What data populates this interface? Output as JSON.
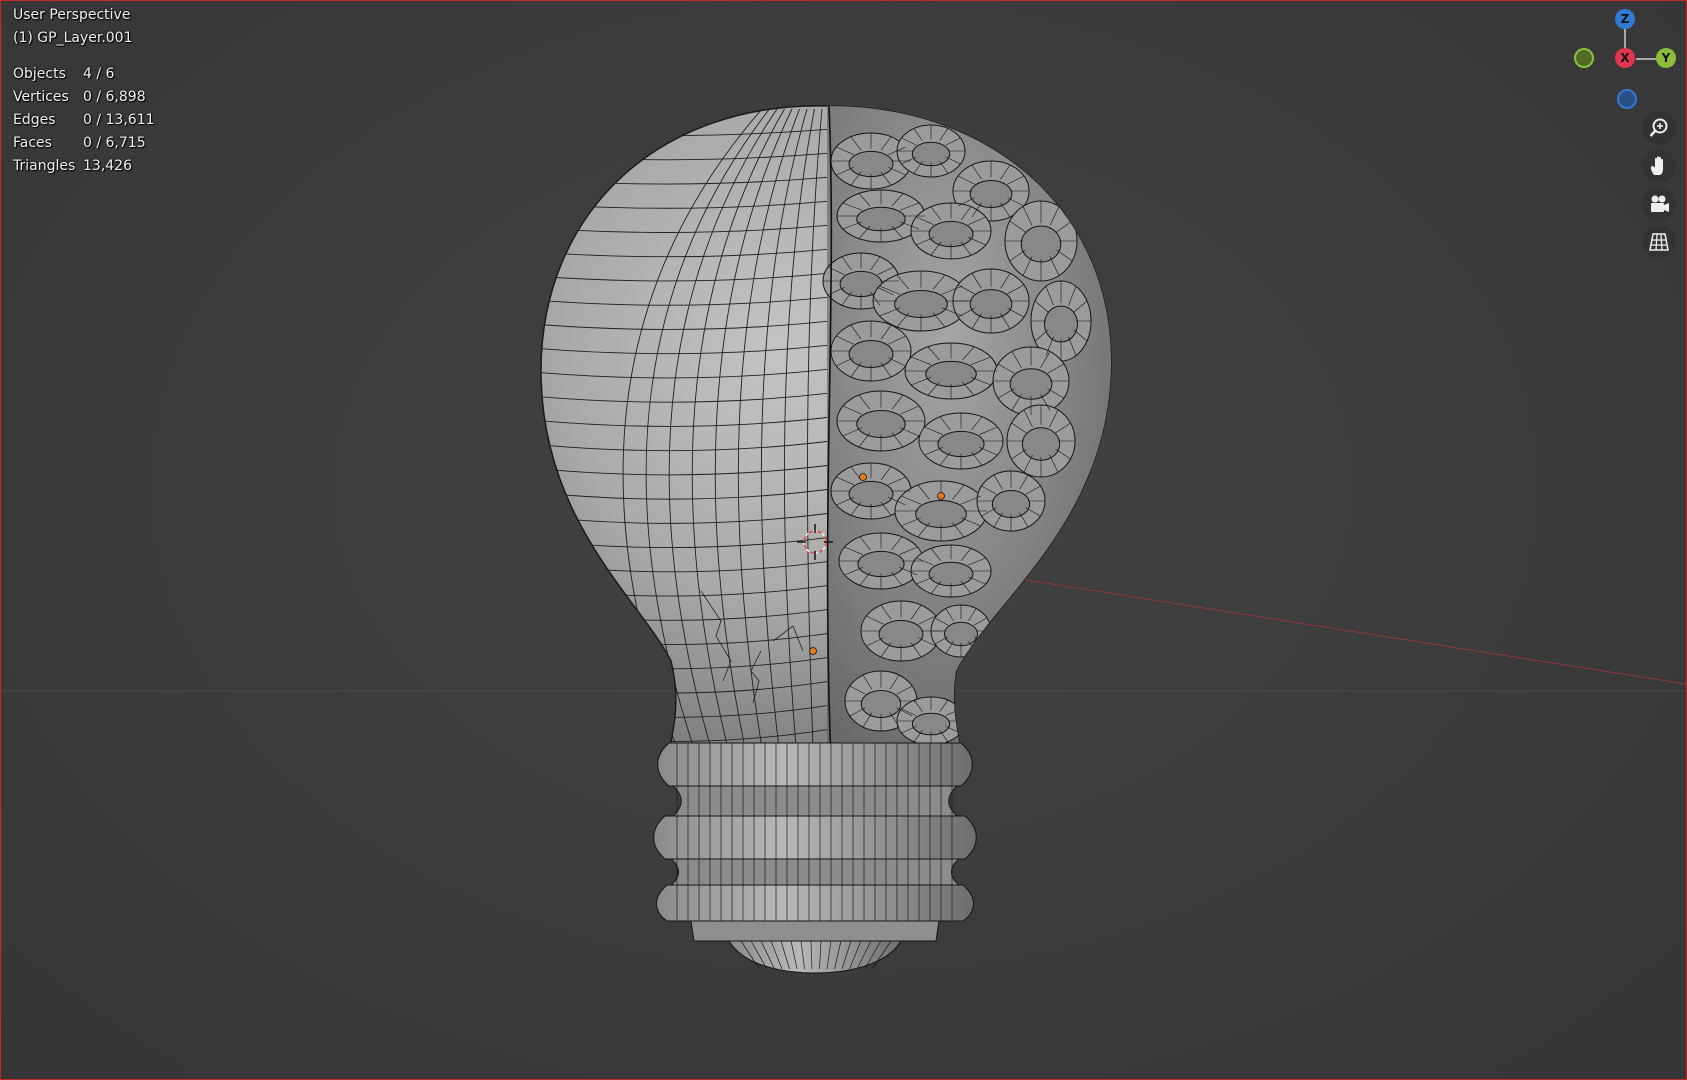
{
  "viewport": {
    "view_name": "User Perspective",
    "active_object": "(1) GP_Layer.001",
    "stats": [
      {
        "label": "Objects",
        "value": "4 / 6"
      },
      {
        "label": "Vertices",
        "value": "0 / 6,898"
      },
      {
        "label": "Edges",
        "value": "0 / 13,611"
      },
      {
        "label": "Faces",
        "value": "0 / 6,715"
      },
      {
        "label": "Triangles",
        "value": "13,426"
      }
    ]
  },
  "gizmo": {
    "z_label": "Z",
    "x_label": "X",
    "y_label": "Y",
    "colors": {
      "x": "#e0364f",
      "y": "#8bbd3a",
      "z": "#2f7bd6"
    }
  },
  "navigation": {
    "buttons": [
      "zoom-icon",
      "hand-pan-icon",
      "camera-icon",
      "grid-ortho-icon"
    ]
  },
  "scene": {
    "object": "lightbulb-brain-mesh",
    "mesh_color": "#a8a8a8",
    "wire_color": "#1a1a1a",
    "cursor_color": "#e8e8e8"
  }
}
